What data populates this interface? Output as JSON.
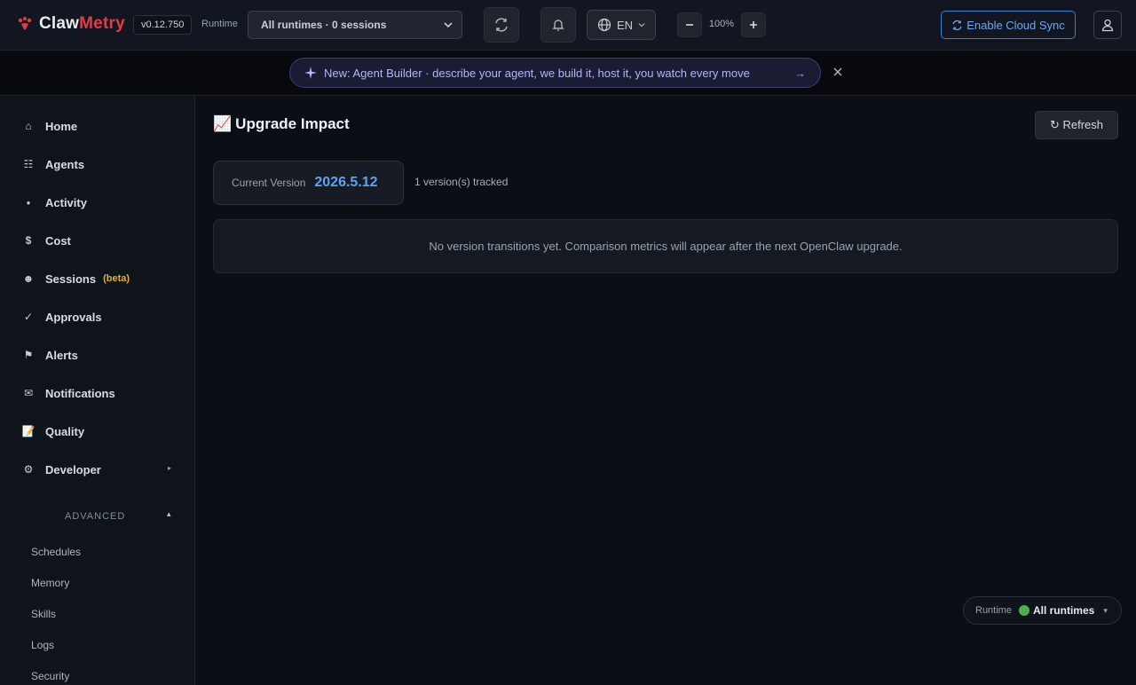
{
  "header": {
    "logo_part1": "Claw",
    "logo_part2": "Metry",
    "version": "v0.12.750",
    "runtime_label": "Runtime",
    "runtime_select_value": "All runtimes · 0 sessions",
    "language": "EN",
    "zoom": "100%",
    "cloud_sync_label": "Enable Cloud Sync"
  },
  "announcement": {
    "text": "New: Agent Builder · describe your agent, we build it, host it, you watch every move",
    "arrow": "→"
  },
  "sidebar": {
    "items": [
      {
        "label": "Home",
        "icon": "home-icon",
        "glyph": "⌂"
      },
      {
        "label": "Agents",
        "icon": "agents-icon",
        "glyph": "☷"
      },
      {
        "label": "Activity",
        "icon": "activity-icon",
        "glyph": "●"
      },
      {
        "label": "Cost",
        "icon": "cost-icon",
        "glyph": "$"
      },
      {
        "label": "Sessions",
        "icon": "sessions-icon",
        "glyph": "☻"
      },
      {
        "label": "Approvals",
        "icon": "approvals-icon",
        "glyph": "✓"
      },
      {
        "label": "Alerts",
        "icon": "alerts-icon",
        "glyph": "⚑"
      },
      {
        "label": "Notifications",
        "icon": "notifications-icon",
        "glyph": "✉"
      },
      {
        "label": "Quality",
        "icon": "quality-icon",
        "glyph": "📝"
      },
      {
        "label": "Developer",
        "icon": "developer-icon",
        "glyph": "⚙"
      }
    ],
    "sessions_badge": "(beta)",
    "developer_caret": "▸",
    "advanced_label": "ADVANCED",
    "advanced_caret": "▴",
    "advanced_items": [
      "Schedules",
      "Memory",
      "Skills",
      "Logs",
      "Security"
    ]
  },
  "main": {
    "title_emoji": "📈",
    "title": "Upgrade Impact",
    "refresh_label": "↻ Refresh",
    "current_version_label": "Current Version",
    "current_version_value": "2026.5.12",
    "tracked_text": "1 version(s) tracked",
    "empty_message": "No version transitions yet. Comparison metrics will appear after the next OpenClaw upgrade."
  },
  "runtime_pill": {
    "label": "Runtime",
    "value": "All runtimes",
    "caret": "▾"
  },
  "colors": {
    "accent_blue": "#5fa3f0",
    "brand_red": "#e23b4a",
    "beta_yellow": "#e3b32a",
    "status_green": "#4caf50"
  }
}
